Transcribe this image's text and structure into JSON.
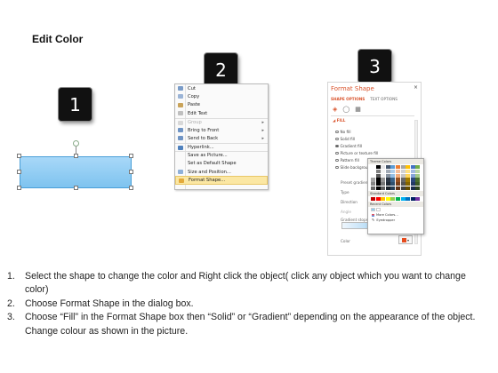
{
  "title": "Edit Color",
  "steps": [
    "1",
    "2",
    "3"
  ],
  "context_menu": {
    "items": [
      {
        "label": "Cut",
        "icon": "cut-icon",
        "arrow": ""
      },
      {
        "label": "Copy",
        "icon": "copy-icon",
        "arrow": ""
      },
      {
        "label": "Paste",
        "icon": "paste-icon",
        "arrow": ""
      },
      {
        "label": "Edit Text",
        "icon": "edit-text-icon",
        "arrow": ""
      },
      {
        "label": "Group",
        "icon": "group-icon",
        "arrow": "▸"
      },
      {
        "label": "Bring to Front",
        "icon": "bring-front-icon",
        "arrow": "▸"
      },
      {
        "label": "Send to Back",
        "icon": "send-back-icon",
        "arrow": "▸"
      },
      {
        "label": "Hyperlink...",
        "icon": "hyperlink-icon",
        "arrow": ""
      },
      {
        "label": "Save as Picture...",
        "icon": "",
        "arrow": ""
      },
      {
        "label": "Set as Default Shape",
        "icon": "",
        "arrow": ""
      },
      {
        "label": "Size and Position...",
        "icon": "size-icon",
        "arrow": ""
      },
      {
        "label": "Format Shape...",
        "icon": "format-shape-icon",
        "arrow": ""
      }
    ]
  },
  "format_pane": {
    "title": "Format Shape",
    "close": "×",
    "tab_shape": "SHAPE OPTIONS",
    "tab_text": "TEXT OPTIONS",
    "fill_header": "◢ FILL",
    "options": [
      "No fill",
      "Solid fill",
      "Gradient fill",
      "Picture or texture fill",
      "Pattern fill",
      "Slide background fill"
    ],
    "props": [
      "Preset gradient",
      "Type",
      "Direction",
      "Angle",
      "Gradient stops",
      "Color"
    ]
  },
  "color_popup": {
    "theme_header": "Theme Colors",
    "standard_header": "Standard Colors",
    "recent_header": "Recent Colors",
    "more_colors": "More Colors...",
    "eyedropper": "Eyedropper"
  },
  "instructions": [
    {
      "num": "1.",
      "text": "Select the shape to change the color and Right click the object( click any object which you want to change color)"
    },
    {
      "num": "2.",
      "text": "Choose Format Shape in the dialog box."
    },
    {
      "num": "3.",
      "text": "Choose “Fill” in the Format Shape box then “Solid” or “Gradient” depending on the appearance of the object. Change colour as shown in the picture."
    }
  ],
  "colors": {
    "accent": "#d9532c",
    "shape_fill": "#8ecbf2",
    "badge": "#111111"
  }
}
